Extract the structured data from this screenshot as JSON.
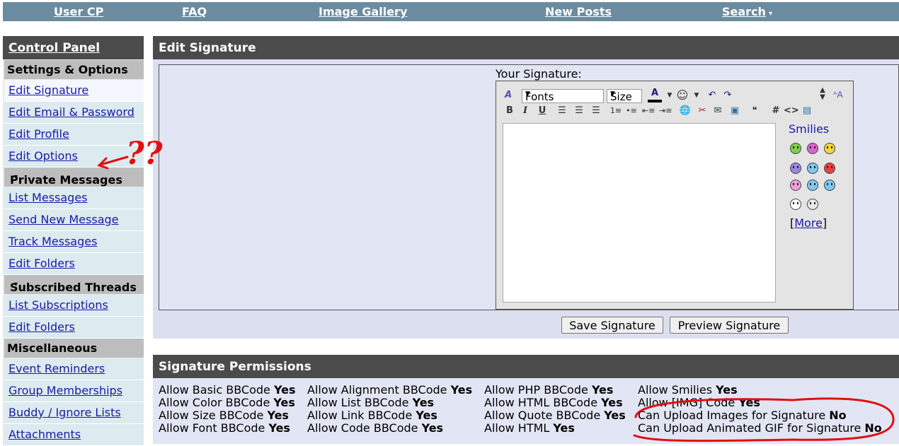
{
  "navbar": {
    "links": [
      "User CP",
      "FAQ",
      "Image Gallery",
      "New Posts",
      "Search"
    ]
  },
  "sidebar": {
    "title": "Control Panel",
    "sections": [
      {
        "heading": "Settings & Options",
        "items": [
          "Edit Signature",
          "Edit Email & Password",
          "Edit Profile",
          "Edit Options"
        ]
      },
      {
        "heading": "Private Messages",
        "items": [
          "List Messages",
          "Send New Message",
          "Track Messages",
          "Edit Folders"
        ]
      },
      {
        "heading": "Subscribed Threads",
        "items": [
          "List Subscriptions",
          "Edit Folders"
        ]
      },
      {
        "heading": "Miscellaneous",
        "items": [
          "Event Reminders",
          "Group Memberships",
          "Buddy / Ignore Lists",
          "Attachments"
        ]
      }
    ]
  },
  "signature": {
    "title": "Edit Signature",
    "label": "Your Signature:",
    "fonts_select": "Fonts",
    "size_select": "Size",
    "smilies_label": "Smilies",
    "more_label": "More",
    "save_button": "Save Signature",
    "preview_button": "Preview Signature"
  },
  "permissions": {
    "title": "Signature Permissions",
    "col1": [
      {
        "label": "Allow Basic BBCode",
        "value": "Yes"
      },
      {
        "label": "Allow Color BBCode",
        "value": "Yes"
      },
      {
        "label": "Allow Size BBCode",
        "value": "Yes"
      },
      {
        "label": "Allow Font BBCode",
        "value": "Yes"
      }
    ],
    "col2": [
      {
        "label": "Allow Alignment BBCode",
        "value": "Yes"
      },
      {
        "label": "Allow List BBCode",
        "value": "Yes"
      },
      {
        "label": "Allow Link BBCode",
        "value": "Yes"
      },
      {
        "label": "Allow Code BBCode",
        "value": "Yes"
      }
    ],
    "col3": [
      {
        "label": "Allow PHP BBCode",
        "value": "Yes"
      },
      {
        "label": "Allow HTML BBCode",
        "value": "Yes"
      },
      {
        "label": "Allow Quote BBCode",
        "value": "Yes"
      },
      {
        "label": "Allow HTML",
        "value": "Yes"
      }
    ],
    "col4": [
      {
        "label": "Allow Smilies",
        "value": "Yes"
      },
      {
        "label": "Allow [IMG] Code",
        "value": "Yes"
      },
      {
        "label": "Can Upload Images for Signature",
        "value": "No"
      },
      {
        "label": "Can Upload Animated GIF for Signature",
        "value": "No"
      }
    ]
  },
  "annotation": {
    "question_marks": "??",
    "color": "#e01010"
  },
  "colors": {
    "navbar": "#6b8ba0",
    "panel_header": "#4b4b4b",
    "sidebar_heading": "#bdbdbd",
    "sidebar_item": "#dcebef",
    "link": "#1a1aa6"
  },
  "smilies_icons": [
    "grin-smiley-icon",
    "tongue-smiley-icon",
    "smile-smiley-icon",
    "sad-smiley-icon",
    "confused-smiley-icon",
    "mad-smiley-icon",
    "wink-smiley-icon",
    "cool-smiley-icon",
    "rolleyes-smiley-icon",
    "sunglasses-smiley-icon",
    "eek-smiley-icon"
  ]
}
